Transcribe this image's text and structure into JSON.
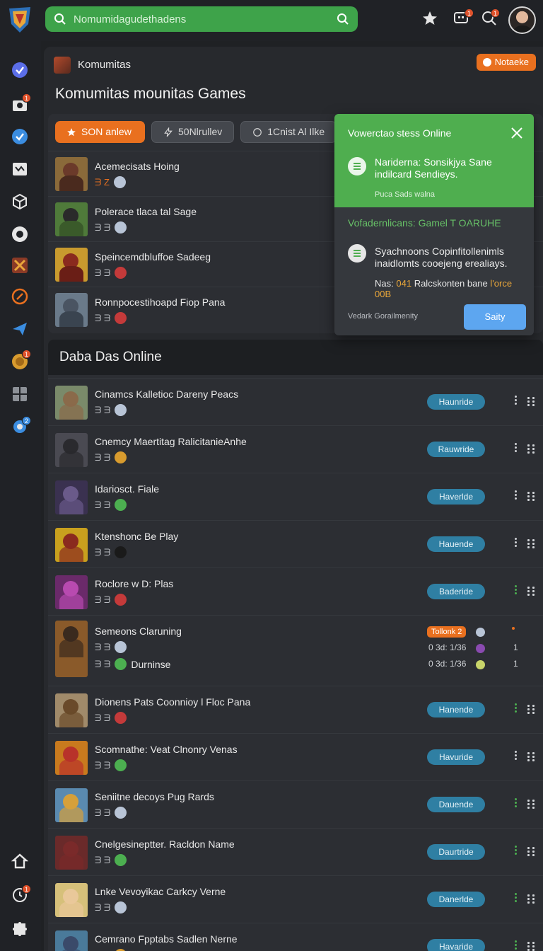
{
  "search": {
    "placeholder": "Nomumidagudethadens"
  },
  "header": {
    "icons": [
      "star-icon",
      "chat-icon",
      "search-icon"
    ],
    "badges": [
      "1",
      "1"
    ]
  },
  "sidebar": {
    "badges": [
      "1",
      "1",
      "2",
      "1"
    ],
    "icons": [
      "check-icon",
      "mail-icon",
      "check-icon",
      "tv-icon",
      "cube-icon",
      "compass-icon",
      "game-icon",
      "target-icon",
      "plane-icon",
      "coin-icon",
      "grid-icon",
      "gear-icon",
      "home-icon",
      "clock-icon",
      "puzzle-icon"
    ]
  },
  "panel": {
    "head_title": "Komumitas",
    "notify_label": "Notaeke",
    "page_title": "Komumitas mounitas Games",
    "filters": [
      "SON anlew",
      "50Nlrullev",
      "1Cnist Al Ilke"
    ]
  },
  "top_rows": [
    {
      "title": "Acemecisats Hoing",
      "meta": "ᗱ Ζ",
      "status": "globe"
    },
    {
      "title": "Polerace tlaca tal Sage",
      "meta": "ᗱ ᗱ",
      "status": "globe"
    },
    {
      "title": "Speincemdbluffoe Sadeeg",
      "meta": "ᗱ ᗱ",
      "status": "red"
    },
    {
      "title": "Ronnpocestihoapd Fiop Pana",
      "meta": "ᗱ ᗱ",
      "status": "red"
    }
  ],
  "popover": {
    "title": "Vowerctao stess Online",
    "item1": "Nariderna: Sonsikjya Sane indilcard Sendieys.",
    "item1_sub": "Puca Sads walna",
    "section": "Vofadernlicans: Gamel T OARUHE",
    "item2": "Syachnoons Copinfitollenimls inaidlomts cooejeng erealiays.",
    "warn_prefix": "Nas:",
    "warn_highlight": "041",
    "warn_text": "Ralcskonten bane",
    "warn_highlight2": "l'orce",
    "warn_tail": "00B",
    "footer": "Vedark Gorailmenity",
    "button": "Saity"
  },
  "online": {
    "title": "Daba Das Online",
    "rows": [
      {
        "title": "Cinamcs Kalletioc Dareny Peacs",
        "meta": "ᗱ ᗱ",
        "status": "globe",
        "action": "Haunride",
        "dot_color": "#cfd2d6"
      },
      {
        "title": "Cnemcy Maertitag RalicitanieAnhe",
        "meta": "ᗱ ᗱ",
        "status": "gold",
        "action": "Rauwride",
        "dot_color": "#cfd2d6"
      },
      {
        "title": "Idariosct. Fiale",
        "meta": "ᗱ ᗱ",
        "status": "green",
        "action": "Haverlde",
        "dot_color": "#cfd2d6"
      },
      {
        "title": "Ktenshonc Be Play",
        "meta": "ᗱ ᗱ",
        "status": "dark",
        "action": "Hauende",
        "dot_color": "#cfd2d6"
      },
      {
        "title": "Roclore w D: Plas",
        "meta": "ᗱ ᗱ",
        "status": "red",
        "action": "Baderide",
        "dot_color": "#4caf50"
      },
      {
        "title": "Semeons Claruning",
        "meta": "ᗱ ᗱ",
        "status": "globe",
        "meta2": "ᗱ ᗱ",
        "status2": "green",
        "extra": "Durninse",
        "badge": "Tollonk 2",
        "small1": "0 3d: 1/36",
        "small2": "0 3d: 1/36",
        "count": "1"
      },
      {
        "title": "Dionens Pats Coonnioy l Floc Pana",
        "meta": "ᗱ ᗱ",
        "status": "red",
        "action": "Hanende",
        "dot_color": "#4caf50"
      },
      {
        "title": "Scomnathe: Veat Clnonry Venas",
        "meta": "ᗱ ᗱ",
        "status": "green",
        "action": "Havuride",
        "dot_color": "#cfd2d6"
      },
      {
        "title": "Seniitne decoys Pug Rards",
        "meta": "ᗱ ᗱ",
        "status": "globe",
        "action": "Dauende",
        "dot_color": "#4caf50"
      },
      {
        "title": "Cnelgesineptter. Racldon Name",
        "meta": "ᗱ ᗱ",
        "status": "green",
        "action": "Daurtride",
        "dot_color": "#4caf50"
      },
      {
        "title": "Lnke Vevoyikac Carkcy Verne",
        "meta": "ᗱ ᗱ",
        "status": "globe",
        "action": "Danerlde",
        "dot_color": "#4caf50"
      },
      {
        "title": "Cemrano Fpptabs Sadlen Nerne",
        "meta": "ᗱ ᗱ",
        "status": "gold",
        "action": "Havaride",
        "dot_color": "#4caf50"
      }
    ]
  }
}
